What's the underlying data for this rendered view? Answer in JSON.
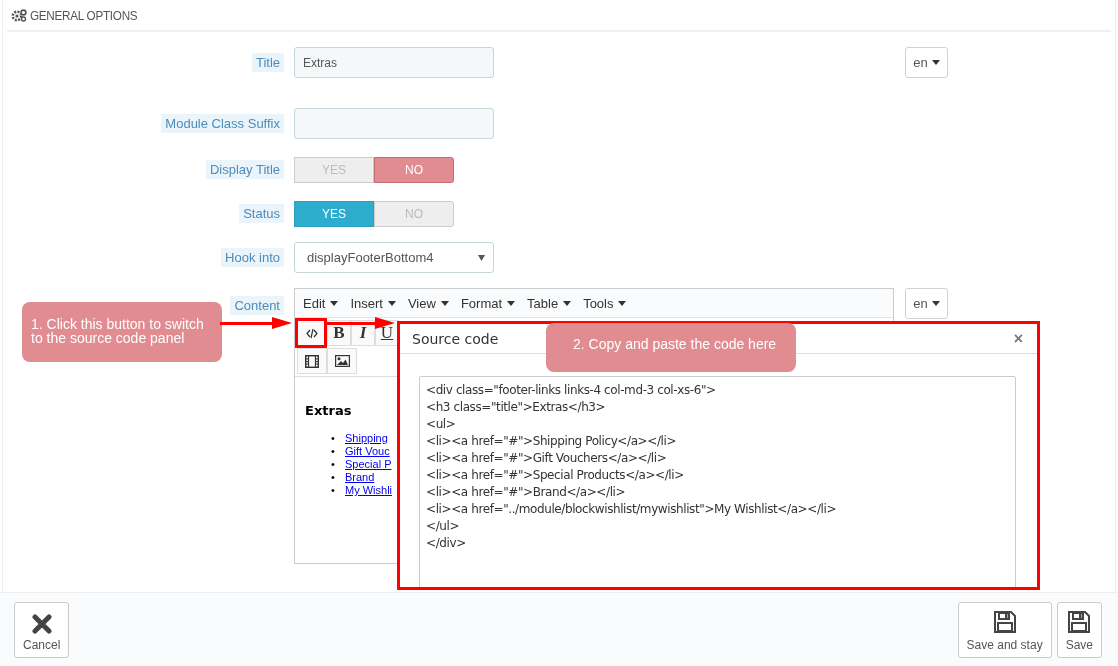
{
  "section": {
    "title": "GENERAL OPTIONS"
  },
  "fields": [
    {
      "kind": "text",
      "label": "Title",
      "value": "Extras",
      "lang": "en"
    },
    {
      "kind": "text",
      "label": "Module Class Suffix"
    },
    {
      "kind": "switch",
      "label": "Display Title",
      "options": [
        {
          "label": "YES",
          "selected": false
        },
        {
          "label": "NO",
          "selected": true
        }
      ]
    },
    {
      "kind": "switch",
      "label": "Status",
      "options": [
        {
          "label": "YES",
          "selected": true
        },
        {
          "label": "NO",
          "selected": false
        }
      ]
    },
    {
      "kind": "select",
      "label": "Hook into",
      "value": "displayFooterBottom4"
    },
    {
      "kind": "editor",
      "label": "Content",
      "lang": "en"
    }
  ],
  "editor": {
    "menus": [
      "Edit",
      "Insert",
      "View",
      "Format",
      "Table",
      "Tools"
    ],
    "toolbar": [
      [
        {
          "kind": "code"
        },
        {
          "kind": "bold",
          "label": "B"
        },
        {
          "kind": "italic",
          "label": "I"
        },
        {
          "kind": "underline",
          "label": "U"
        }
      ],
      [
        {
          "kind": "video"
        },
        {
          "kind": "image"
        }
      ]
    ],
    "heading": "Extras",
    "links": [
      {
        "bullet": "•",
        "text": "Shipping"
      },
      {
        "bullet": "•",
        "text": "Gift Vouc"
      },
      {
        "bullet": "•",
        "text": "Special P"
      },
      {
        "bullet": "•",
        "text": "Brand"
      },
      {
        "bullet": "•",
        "text": "My Wishli"
      }
    ]
  },
  "source_dialog": {
    "title": "Source code",
    "close": "×",
    "code": [
      "<div class=\"footer-links links-4 col-md-3 col-xs-6\">",
      "<h3 class=\"title\">Extras</h3>",
      "<ul>",
      "<li><a href=\"#\">Shipping Policy</a></li>",
      "<li><a href=\"#\">Gift Vouchers</a></li>",
      "<li><a href=\"#\">Special Products</a></li>",
      "<li><a href=\"#\">Brand</a></li>",
      "<li><a href=\"../module/blockwishlist/mywishlist\">My Wishlist</a></li>",
      "</ul>",
      "</div>"
    ]
  },
  "callouts": [
    "1. Click this button to switch to the source code panel",
    "2. Copy and paste the code here"
  ],
  "footer": {
    "buttons": [
      {
        "kind": "cancel",
        "label": "Cancel"
      },
      {
        "kind": "save",
        "label": "Save and stay"
      },
      {
        "kind": "save",
        "label": "Save"
      }
    ]
  }
}
